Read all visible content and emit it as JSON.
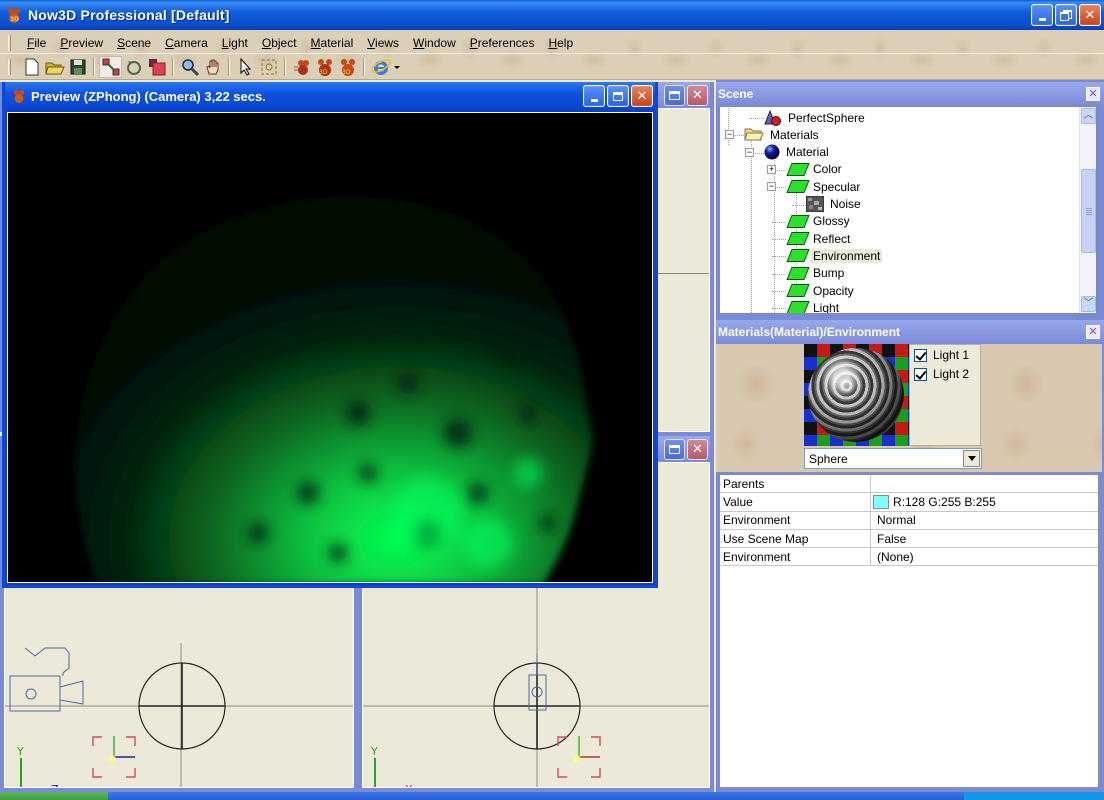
{
  "window": {
    "title": "Now3D Professional [Default]"
  },
  "menu": [
    {
      "label": "File",
      "mnemonic": "F",
      "rest": "ile"
    },
    {
      "label": "Preview",
      "mnemonic": "P",
      "rest": "review"
    },
    {
      "label": "Scene",
      "mnemonic": "S",
      "rest": "cene"
    },
    {
      "label": "Camera",
      "mnemonic": "C",
      "rest": "amera"
    },
    {
      "label": "Light",
      "mnemonic": "L",
      "rest": "ight"
    },
    {
      "label": "Object",
      "mnemonic": "O",
      "rest": "bject"
    },
    {
      "label": "Material",
      "mnemonic": "M",
      "rest": "aterial"
    },
    {
      "label": "Views",
      "mnemonic": "V",
      "rest": "iews"
    },
    {
      "label": "Window",
      "mnemonic": "W",
      "rest": "indow"
    },
    {
      "label": "Preferences",
      "mnemonic": "P",
      "rest": "references"
    },
    {
      "label": "Help",
      "mnemonic": "H",
      "rest": "elp"
    }
  ],
  "toolbar": {
    "buttons": [
      {
        "icon": "new-document-icon"
      },
      {
        "icon": "open-folder-icon"
      },
      {
        "icon": "save-disk-icon"
      },
      {
        "sep": true
      },
      {
        "icon": "move-tool-icon",
        "active": true
      },
      {
        "icon": "rotate-tool-icon"
      },
      {
        "icon": "scale-tool-icon"
      },
      {
        "sep": true
      },
      {
        "icon": "zoom-magnifier-icon"
      },
      {
        "icon": "pan-hand-icon"
      },
      {
        "sep": true
      },
      {
        "icon": "select-arrow-icon"
      },
      {
        "icon": "select-region-icon"
      },
      {
        "sep": true
      },
      {
        "icon": "render-fast-icon"
      },
      {
        "icon": "render-bunny-icon"
      },
      {
        "icon": "render-3d-icon"
      },
      {
        "sep": true
      },
      {
        "icon": "internet-explorer-icon"
      },
      {
        "icon": "dropdown-arrow-icon"
      }
    ]
  },
  "preview_window": {
    "title": "Preview (ZPhong) (Camera) 3,22 secs."
  },
  "viewports": {
    "bottom_left": {
      "axis_v": "Y",
      "axis_h": "Z"
    },
    "bottom_right": {
      "axis_v": "Y",
      "axis_h": "X"
    }
  },
  "scene_panel": {
    "title": "Scene",
    "tree": [
      {
        "label": "PerfectSphere",
        "icon": "primitive-shapes-icon",
        "level": 2
      },
      {
        "label": "Materials",
        "icon": "folder-open-icon",
        "level": 1,
        "expander": "-"
      },
      {
        "label": "Material",
        "icon": "material-sphere-icon",
        "level": 2,
        "expander": "-"
      },
      {
        "label": "Color",
        "icon": "channel-icon",
        "level": 3,
        "expander": "+"
      },
      {
        "label": "Specular",
        "icon": "channel-icon",
        "level": 3,
        "expander": "-"
      },
      {
        "label": "Noise",
        "icon": "noise-texture-icon",
        "level": 4
      },
      {
        "label": "Glossy",
        "icon": "channel-icon",
        "level": 3
      },
      {
        "label": "Reflect",
        "icon": "channel-icon",
        "level": 3
      },
      {
        "label": "Environment",
        "icon": "channel-icon",
        "level": 3,
        "selected": true
      },
      {
        "label": "Bump",
        "icon": "channel-icon",
        "level": 3
      },
      {
        "label": "Opacity",
        "icon": "channel-icon",
        "level": 3
      },
      {
        "label": "Light",
        "icon": "channel-icon",
        "level": 3
      }
    ]
  },
  "material_panel": {
    "title": "Materials(Material)/Environment",
    "lights": [
      {
        "label": "Light 1",
        "checked": true
      },
      {
        "label": "Light 2",
        "checked": true
      }
    ],
    "shape_select": "Sphere",
    "properties": [
      {
        "name": "Parents",
        "value": ""
      },
      {
        "name": "Value",
        "value": "R:128 G:255 B:255",
        "color": "#80ffff"
      },
      {
        "name": "Environment",
        "value": "Normal"
      },
      {
        "name": "Use Scene Map",
        "value": "False"
      },
      {
        "name": "Environment",
        "value": "(None)"
      }
    ]
  },
  "colors": {
    "title_blue": "#0a4ccb",
    "panel_blue": "#7b8ad6",
    "render_green": "#00ff55"
  }
}
